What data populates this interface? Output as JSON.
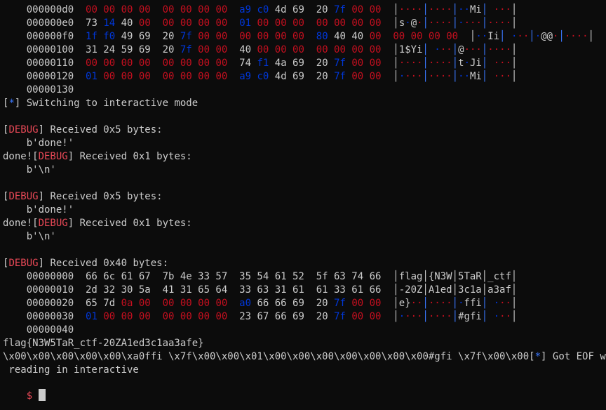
{
  "colors": {
    "background": "#0c0c0c",
    "text": "#cccccc",
    "zero_bytes": "#c50f1f",
    "high_bytes": "#0037da",
    "debug_tag": "#e74856",
    "info_star": "#3b78ff",
    "prompt": "#e74856"
  },
  "lines": [
    [
      {
        "t": "    000000d0  ",
        "c": "w"
      },
      {
        "t": "00 00 00 00  00 00 00 00  ",
        "c": "r"
      },
      {
        "t": "a9 c0 ",
        "c": "b"
      },
      {
        "t": "4d 69  20 ",
        "c": "w"
      },
      {
        "t": "7f ",
        "c": "b"
      },
      {
        "t": "00 00",
        "c": "r"
      },
      {
        "t": "  │",
        "c": "w"
      },
      {
        "t": "····",
        "c": "r"
      },
      {
        "t": "│",
        "c": "sep"
      },
      {
        "t": "····",
        "c": "r"
      },
      {
        "t": "│",
        "c": "sep"
      },
      {
        "t": "··",
        "c": "b"
      },
      {
        "t": "Mi",
        "c": "w"
      },
      {
        "t": "│ ",
        "c": "sep"
      },
      {
        "t": "···",
        "c": "r"
      },
      {
        "t": "│",
        "c": "w"
      }
    ],
    [
      {
        "t": "    000000e0  ",
        "c": "w"
      },
      {
        "t": "73 ",
        "c": "w"
      },
      {
        "t": "14 ",
        "c": "b"
      },
      {
        "t": "40 ",
        "c": "w"
      },
      {
        "t": "00  00 00 00 00  ",
        "c": "r"
      },
      {
        "t": "01 ",
        "c": "b"
      },
      {
        "t": "00 00 00  00 00 00 00",
        "c": "r"
      },
      {
        "t": "  │",
        "c": "w"
      },
      {
        "t": "s",
        "c": "w"
      },
      {
        "t": "·",
        "c": "b"
      },
      {
        "t": "@",
        "c": "w"
      },
      {
        "t": "·",
        "c": "r"
      },
      {
        "t": "│",
        "c": "sep"
      },
      {
        "t": "····",
        "c": "r"
      },
      {
        "t": "│",
        "c": "sep"
      },
      {
        "t": "·",
        "c": "b"
      },
      {
        "t": "···",
        "c": "r"
      },
      {
        "t": "│",
        "c": "sep"
      },
      {
        "t": "····",
        "c": "r"
      },
      {
        "t": "│",
        "c": "w"
      }
    ],
    [
      {
        "t": "    000000f0  ",
        "c": "w"
      },
      {
        "t": "1f f0 ",
        "c": "b"
      },
      {
        "t": "49 69  20 ",
        "c": "w"
      },
      {
        "t": "7f ",
        "c": "b"
      },
      {
        "t": "00 00  00 00 00 00  ",
        "c": "r"
      },
      {
        "t": "80 ",
        "c": "b"
      },
      {
        "t": "40 40 ",
        "c": "w"
      },
      {
        "t": "00  00 00 00 00",
        "c": "r"
      },
      {
        "t": "  │",
        "c": "w"
      },
      {
        "t": "··",
        "c": "b"
      },
      {
        "t": "Ii",
        "c": "w"
      },
      {
        "t": "│",
        "c": "sep"
      },
      {
        "t": " ",
        "c": "w"
      },
      {
        "t": "·",
        "c": "b"
      },
      {
        "t": "··",
        "c": "r"
      },
      {
        "t": "│",
        "c": "sep"
      },
      {
        "t": "·",
        "c": "b"
      },
      {
        "t": "@@",
        "c": "w"
      },
      {
        "t": "·",
        "c": "r"
      },
      {
        "t": "│",
        "c": "sep"
      },
      {
        "t": "····",
        "c": "r"
      },
      {
        "t": "│",
        "c": "w"
      }
    ],
    [
      {
        "t": "    00000100  ",
        "c": "w"
      },
      {
        "t": "31 24 59 69  20 ",
        "c": "w"
      },
      {
        "t": "7f ",
        "c": "b"
      },
      {
        "t": "00 00  ",
        "c": "r"
      },
      {
        "t": "40 ",
        "c": "w"
      },
      {
        "t": "00 00 00  00 00 00 00",
        "c": "r"
      },
      {
        "t": "  │",
        "c": "w"
      },
      {
        "t": "1$Yi",
        "c": "w"
      },
      {
        "t": "│",
        "c": "sep"
      },
      {
        "t": " ",
        "c": "w"
      },
      {
        "t": "·",
        "c": "b"
      },
      {
        "t": "··",
        "c": "r"
      },
      {
        "t": "│",
        "c": "sep"
      },
      {
        "t": "@",
        "c": "w"
      },
      {
        "t": "···",
        "c": "r"
      },
      {
        "t": "│",
        "c": "sep"
      },
      {
        "t": "····",
        "c": "r"
      },
      {
        "t": "│",
        "c": "w"
      }
    ],
    [
      {
        "t": "    00000110  ",
        "c": "w"
      },
      {
        "t": "00 00 00 00  00 00 00 00  ",
        "c": "r"
      },
      {
        "t": "74 ",
        "c": "w"
      },
      {
        "t": "f1 ",
        "c": "b"
      },
      {
        "t": "4a 69  20 ",
        "c": "w"
      },
      {
        "t": "7f ",
        "c": "b"
      },
      {
        "t": "00 00",
        "c": "r"
      },
      {
        "t": "  │",
        "c": "w"
      },
      {
        "t": "····",
        "c": "r"
      },
      {
        "t": "│",
        "c": "sep"
      },
      {
        "t": "····",
        "c": "r"
      },
      {
        "t": "│",
        "c": "sep"
      },
      {
        "t": "t",
        "c": "w"
      },
      {
        "t": "·",
        "c": "b"
      },
      {
        "t": "Ji",
        "c": "w"
      },
      {
        "t": "│ ",
        "c": "sep"
      },
      {
        "t": "···",
        "c": "r"
      },
      {
        "t": "│",
        "c": "w"
      }
    ],
    [
      {
        "t": "    00000120  ",
        "c": "w"
      },
      {
        "t": "01 ",
        "c": "b"
      },
      {
        "t": "00 00 00  00 00 00 00  ",
        "c": "r"
      },
      {
        "t": "a9 c0 ",
        "c": "b"
      },
      {
        "t": "4d 69  20 ",
        "c": "w"
      },
      {
        "t": "7f ",
        "c": "b"
      },
      {
        "t": "00 00",
        "c": "r"
      },
      {
        "t": "  │",
        "c": "w"
      },
      {
        "t": "·",
        "c": "b"
      },
      {
        "t": "···",
        "c": "r"
      },
      {
        "t": "│",
        "c": "sep"
      },
      {
        "t": "····",
        "c": "r"
      },
      {
        "t": "│",
        "c": "sep"
      },
      {
        "t": "··",
        "c": "b"
      },
      {
        "t": "Mi",
        "c": "w"
      },
      {
        "t": "│ ",
        "c": "sep"
      },
      {
        "t": "···",
        "c": "r"
      },
      {
        "t": "│",
        "c": "w"
      }
    ],
    [
      {
        "t": "    00000130",
        "c": "w"
      }
    ],
    [
      {
        "t": "[",
        "c": "w"
      },
      {
        "t": "*",
        "c": "star"
      },
      {
        "t": "] Switching to interactive mode",
        "c": "w"
      }
    ],
    [],
    [
      {
        "t": "[",
        "c": "w"
      },
      {
        "t": "DEBUG",
        "c": "dbg"
      },
      {
        "t": "] Received 0x5 bytes:",
        "c": "w"
      }
    ],
    [
      {
        "t": "    b'done!'",
        "c": "w"
      }
    ],
    [
      {
        "t": "done![",
        "c": "w"
      },
      {
        "t": "DEBUG",
        "c": "dbg"
      },
      {
        "t": "] Received 0x1 bytes:",
        "c": "w"
      }
    ],
    [
      {
        "t": "    b'\\n'",
        "c": "w"
      }
    ],
    [],
    [
      {
        "t": "[",
        "c": "w"
      },
      {
        "t": "DEBUG",
        "c": "dbg"
      },
      {
        "t": "] Received 0x5 bytes:",
        "c": "w"
      }
    ],
    [
      {
        "t": "    b'done!'",
        "c": "w"
      }
    ],
    [
      {
        "t": "done![",
        "c": "w"
      },
      {
        "t": "DEBUG",
        "c": "dbg"
      },
      {
        "t": "] Received 0x1 bytes:",
        "c": "w"
      }
    ],
    [
      {
        "t": "    b'\\n'",
        "c": "w"
      }
    ],
    [],
    [
      {
        "t": "[",
        "c": "w"
      },
      {
        "t": "DEBUG",
        "c": "dbg"
      },
      {
        "t": "] Received 0x40 bytes:",
        "c": "w"
      }
    ],
    [
      {
        "t": "    00000000  66 6c 61 67  7b 4e 33 57  35 54 61 52  5f 63 74 66  │flag│{N3W│5TaR│_ctf│",
        "c": "w"
      }
    ],
    [
      {
        "t": "    00000010  2d 32 30 5a  41 31 65 64  33 63 31 61  61 33 61 66  │-20Z│A1ed│3c1a│a3af│",
        "c": "w"
      }
    ],
    [
      {
        "t": "    00000020  65 7d ",
        "c": "w"
      },
      {
        "t": "0a 00  00 00 00 00  ",
        "c": "r"
      },
      {
        "t": "a0 ",
        "c": "b"
      },
      {
        "t": "66 66 69  20 ",
        "c": "w"
      },
      {
        "t": "7f ",
        "c": "b"
      },
      {
        "t": "00 00",
        "c": "r"
      },
      {
        "t": "  │",
        "c": "w"
      },
      {
        "t": "e}",
        "c": "w"
      },
      {
        "t": "··",
        "c": "r"
      },
      {
        "t": "│",
        "c": "sep"
      },
      {
        "t": "····",
        "c": "r"
      },
      {
        "t": "│",
        "c": "sep"
      },
      {
        "t": "·",
        "c": "b"
      },
      {
        "t": "ffi",
        "c": "w"
      },
      {
        "t": "│ ",
        "c": "sep"
      },
      {
        "t": "·",
        "c": "b"
      },
      {
        "t": "··",
        "c": "r"
      },
      {
        "t": "│",
        "c": "w"
      }
    ],
    [
      {
        "t": "    00000030  ",
        "c": "w"
      },
      {
        "t": "01 ",
        "c": "b"
      },
      {
        "t": "00 00 00  00 00 00 00  ",
        "c": "r"
      },
      {
        "t": "23 67 66 69  20 ",
        "c": "w"
      },
      {
        "t": "7f ",
        "c": "b"
      },
      {
        "t": "00 00",
        "c": "r"
      },
      {
        "t": "  │",
        "c": "w"
      },
      {
        "t": "·",
        "c": "b"
      },
      {
        "t": "···",
        "c": "r"
      },
      {
        "t": "│",
        "c": "sep"
      },
      {
        "t": "····",
        "c": "r"
      },
      {
        "t": "│",
        "c": "sep"
      },
      {
        "t": "#gfi",
        "c": "w"
      },
      {
        "t": "│ ",
        "c": "sep"
      },
      {
        "t": "·",
        "c": "b"
      },
      {
        "t": "··",
        "c": "r"
      },
      {
        "t": "│",
        "c": "w"
      }
    ],
    [
      {
        "t": "    00000040",
        "c": "w"
      }
    ],
    [
      {
        "t": "flag{N3W5TaR_ctf-20ZA1ed3c1aa3afe}",
        "c": "w"
      }
    ],
    [
      {
        "t": "\\x00\\x00\\x00\\x00\\x00\\xa0ffi \\x7f\\x00\\x00\\x01\\x00\\x00\\x00\\x00\\x00\\x00\\x00#gfi \\x7f\\x00\\x00[",
        "c": "w"
      },
      {
        "t": "*",
        "c": "star"
      },
      {
        "t": "] Got EOF while",
        "c": "w"
      }
    ],
    [
      {
        "t": " reading in interactive",
        "c": "w"
      }
    ]
  ],
  "prompt": {
    "symbol": "$",
    "input_value": ""
  }
}
